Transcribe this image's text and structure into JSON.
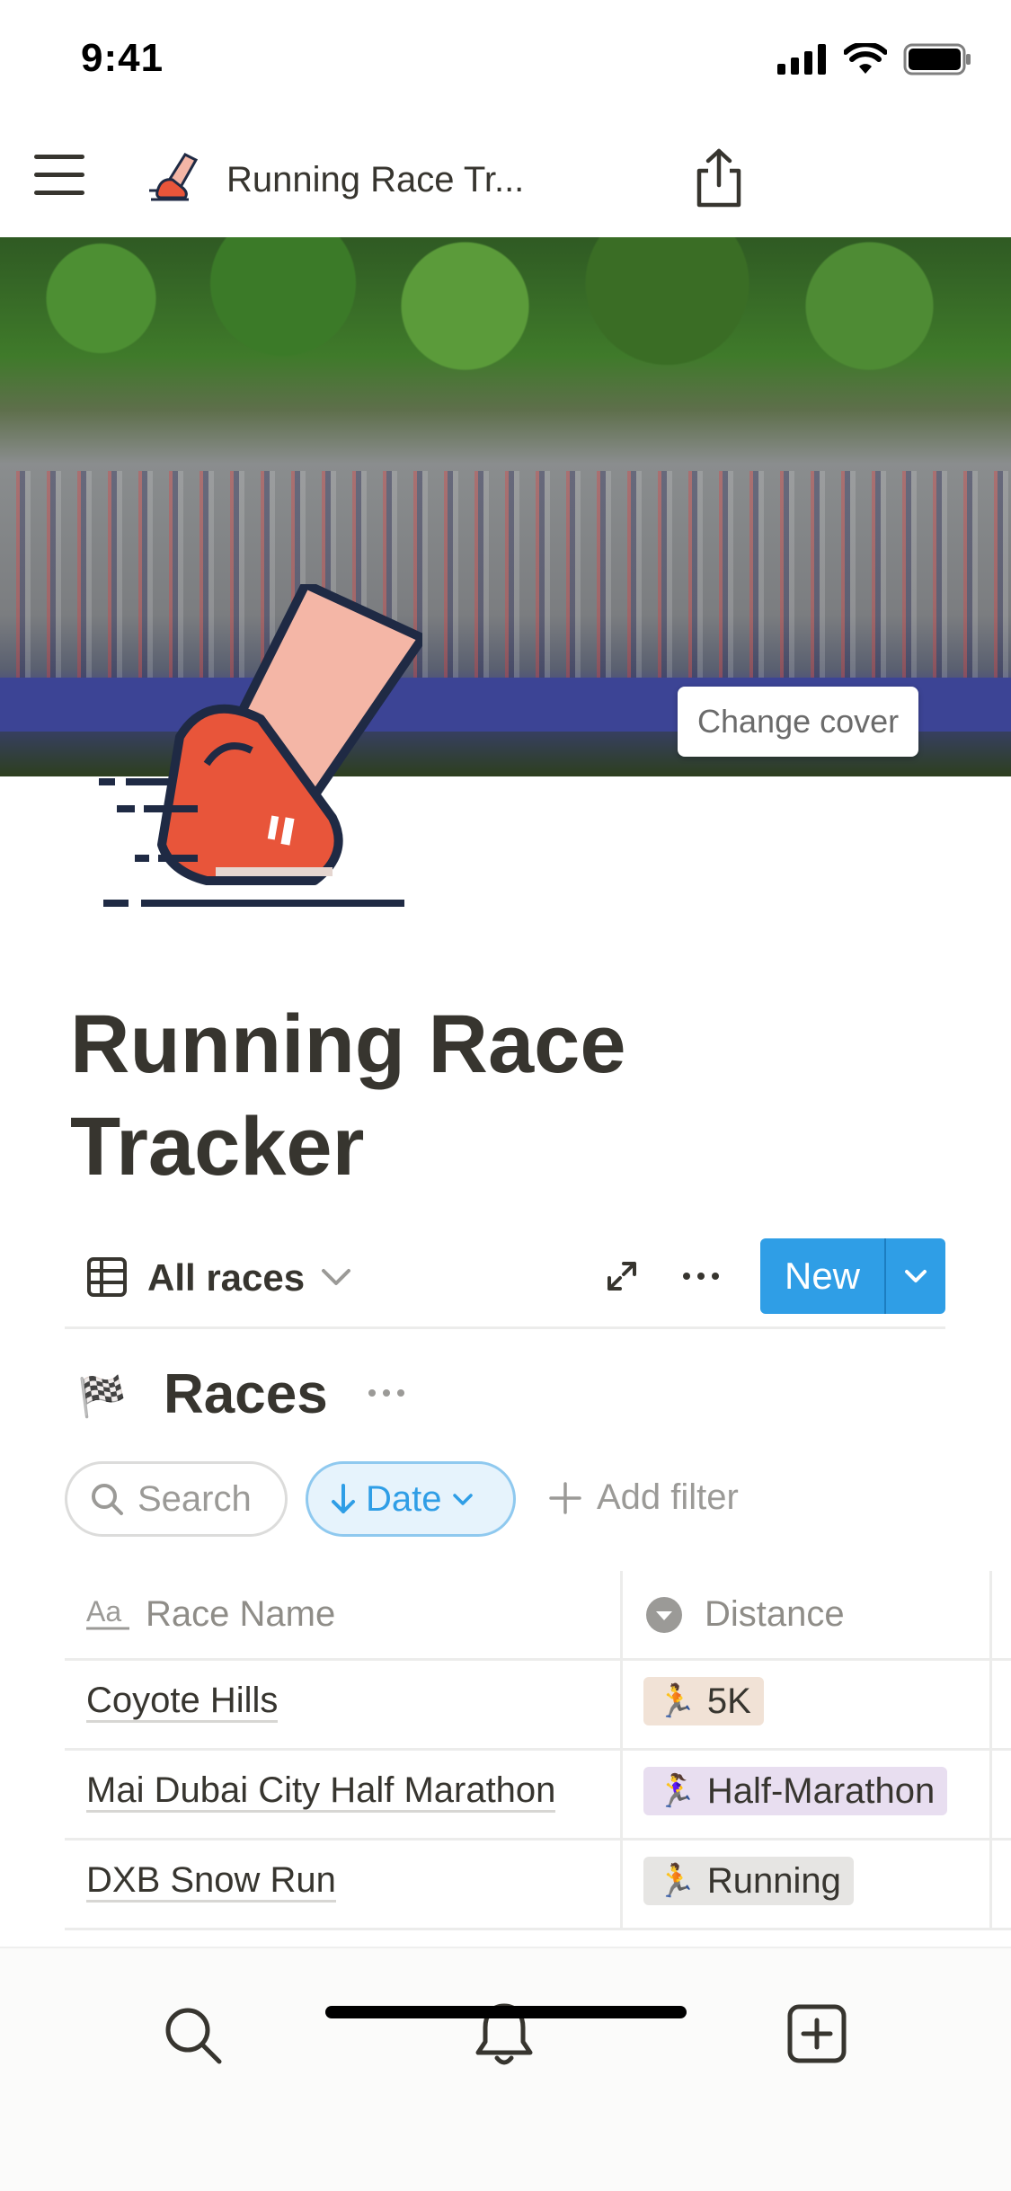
{
  "status_bar": {
    "time": "9:41"
  },
  "topbar": {
    "title": "Running Race Tr...",
    "icons": [
      "menu-icon",
      "page-icon",
      "share-icon"
    ]
  },
  "cover": {
    "change_cover_label": "Change cover"
  },
  "page": {
    "title": "Running Race Tracker"
  },
  "view": {
    "label": "All races",
    "new_label": "New"
  },
  "database": {
    "flag_emoji": "🏁",
    "title": "Races"
  },
  "filters": {
    "search_label": "Search",
    "sort_label": "Date",
    "add_filter_label": "Add filter"
  },
  "table": {
    "columns": [
      {
        "label": "Race Name",
        "icon": "text-property-icon"
      },
      {
        "label": "Distance",
        "icon": "select-property-icon"
      }
    ],
    "rows": [
      {
        "name": "Coyote Hills",
        "distance": "5K",
        "emoji": "🏃",
        "tag_color": "#f1e2d6"
      },
      {
        "name": "Mai Dubai City Half Marathon",
        "distance": "Half-Marathon",
        "emoji": "🏃‍♀️",
        "tag_color": "#e8def0"
      },
      {
        "name": "DXB Snow Run",
        "distance": "Running",
        "emoji": "🏃",
        "tag_color": "#e6e5e3"
      }
    ]
  },
  "tabbar": {
    "items": [
      "search-icon",
      "bell-icon",
      "new-page-icon"
    ]
  }
}
